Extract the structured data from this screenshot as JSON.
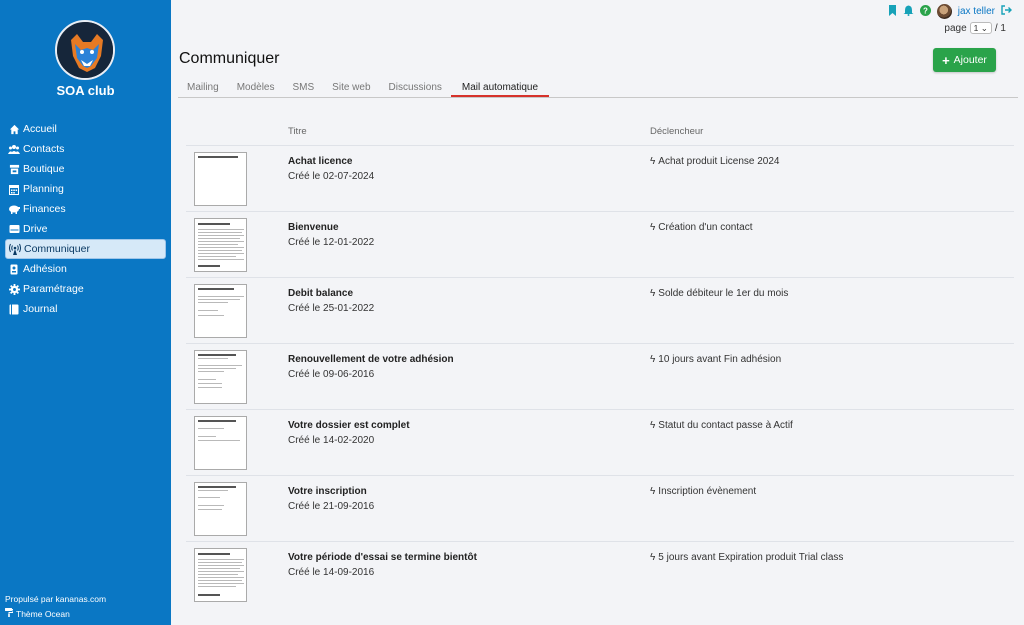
{
  "club": {
    "name": "SOA club"
  },
  "sidebar": {
    "items": [
      {
        "label": "Accueil",
        "icon": "home-icon"
      },
      {
        "label": "Contacts",
        "icon": "users-icon"
      },
      {
        "label": "Boutique",
        "icon": "store-icon"
      },
      {
        "label": "Planning",
        "icon": "calendar-icon"
      },
      {
        "label": "Finances",
        "icon": "piggy-bank-icon"
      },
      {
        "label": "Drive",
        "icon": "drive-icon"
      },
      {
        "label": "Communiquer",
        "icon": "broadcast-icon",
        "active": true
      },
      {
        "label": "Adhésion",
        "icon": "id-card-icon"
      },
      {
        "label": "Paramétrage",
        "icon": "gear-icon"
      },
      {
        "label": "Journal",
        "icon": "book-icon"
      }
    ],
    "footer": {
      "powered": "Propulsé par kananas.com",
      "theme": "Thème Ocean"
    }
  },
  "topbar": {
    "user": "jax teller",
    "icons": [
      "bookmark-icon",
      "bell-icon",
      "help-icon",
      "logout-icon"
    ],
    "pager": {
      "label": "page",
      "current": "1",
      "total": "/ 1"
    }
  },
  "header": {
    "title": "Communiquer",
    "add_label": "Ajouter"
  },
  "tabs": [
    "Mailing",
    "Modèles",
    "SMS",
    "Site web",
    "Discussions",
    "Mail automatique"
  ],
  "active_tab": "Mail automatique",
  "table": {
    "headers": {
      "title": "Titre",
      "trigger": "Déclencheur"
    },
    "rows": [
      {
        "title": "Achat licence",
        "date": "Créé le 02-07-2024",
        "trigger": "Achat produit License 2024"
      },
      {
        "title": "Bienvenue",
        "date": "Créé le 12-01-2022",
        "trigger": "Création d'un contact"
      },
      {
        "title": "Debit balance",
        "date": "Créé le 25-01-2022",
        "trigger": "Solde débiteur le 1er du mois"
      },
      {
        "title": "Renouvellement de votre adhésion",
        "date": "Créé le 09-06-2016",
        "trigger": "10 jours avant Fin adhésion"
      },
      {
        "title": "Votre dossier est complet",
        "date": "Créé le 14-02-2020",
        "trigger": "Statut du contact passe à Actif"
      },
      {
        "title": "Votre inscription",
        "date": "Créé le 21-09-2016",
        "trigger": "Inscription évènement"
      },
      {
        "title": "Votre période d'essai se termine bientôt",
        "date": "Créé le 14-09-2016",
        "trigger": "5 jours avant Expiration produit Trial class"
      }
    ]
  },
  "colors": {
    "sidebar": "#0a77c4",
    "accent_tab": "#d6322b",
    "add_button": "#2aa34a",
    "background": "#f3f4f7"
  }
}
